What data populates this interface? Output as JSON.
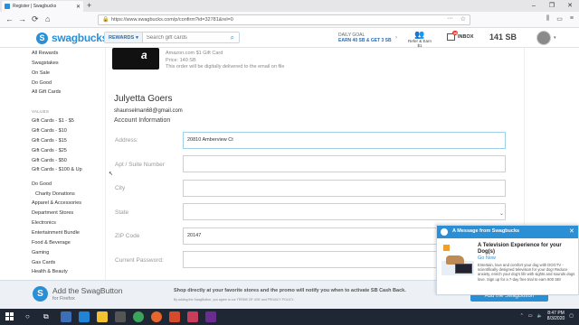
{
  "browser": {
    "tab_title": "Register | Swagbucks",
    "tab_close": "✕",
    "new_tab": "+",
    "window_controls": [
      "–",
      "❐",
      "✕"
    ],
    "url": "https://www.swagbucks.com/p/confirm?id=32781&rel=0",
    "nav_back": "←",
    "nav_forward": "→",
    "nav_reload": "⟳",
    "nav_home": "⌂",
    "more_menu": "···",
    "star": "☆",
    "right_icons": [
      "⫼",
      "▭",
      "≡"
    ]
  },
  "header": {
    "logo_text": "swagbucks",
    "search_scope": "REWARDS",
    "search_placeholder": "Search gift cards",
    "daily_goal_title": "DAILY GOAL",
    "daily_goal_text": "EARN 40 SB & GET 3 SB",
    "refer_label": "Refer & Earn $1",
    "inbox_label": "INBOX",
    "inbox_count": "10",
    "balance": "141 SB"
  },
  "sidebar": {
    "links_top": [
      "All Rewards",
      "Swagstakes",
      "On Sale",
      "Do Good",
      "All Gift Cards"
    ],
    "values_heading": "VALUES",
    "values": [
      "Gift Cards - $1 - $5",
      "Gift Cards - $10",
      "Gift Cards - $15",
      "Gift Cards - $25",
      "Gift Cards - $50",
      "Gift Cards - $100 & Up"
    ],
    "categories": [
      "Do Good",
      "Charity Donations",
      "Apparel & Accessories",
      "Department Stores",
      "Electronics",
      "Entertainment Bundle",
      "Food & Beverage",
      "Gaming",
      "Gas Cards",
      "Health & Beauty"
    ]
  },
  "gift": {
    "logo": "a",
    "name": "Amazon.com $1 Gift Card",
    "price": "Price: 140 SB",
    "note": "This order will be digitally delivered to the email on file"
  },
  "account": {
    "name": "Julyetta Goers",
    "email": "shaunselman68@gmail.com",
    "section_title": "Account Information",
    "labels": {
      "address": "Address:",
      "apt": "Apt / Suite Number",
      "city": "City",
      "state": "State",
      "zip": "ZIP Code",
      "password": "Current Password:"
    },
    "values": {
      "address": "20810 Amberview Ct",
      "zip": "20147"
    }
  },
  "extension": {
    "title": "Add the SwagButton",
    "subtitle": "for Firefox",
    "message": "Shop directly at your favorite stores and the promo will notify you when to activate SB Cash Back.",
    "legal": "By adding the SwagButton, you agree to our TERMS OF USE and PRIVACY POLICY.",
    "button": "Add the SwagButton"
  },
  "popup": {
    "title": "A Message from Swagbucks",
    "close": "✕",
    "headline": "A Television Experience for your Dog(s)",
    "link": "Go Now",
    "body": "Entertain, love and comfort your dog with DOGTV - scientifically designed television for your dog! Reduce anxiety, enrich your dog's life with sights and sounds dogs love. Sign up for a 7-day free trial to earn 600 SB!"
  },
  "taskbar": {
    "time": "8:47 PM",
    "date": "8/3/2020"
  },
  "colors": {
    "brand": "#2a8fd4",
    "taskbar": "#1f2634"
  }
}
